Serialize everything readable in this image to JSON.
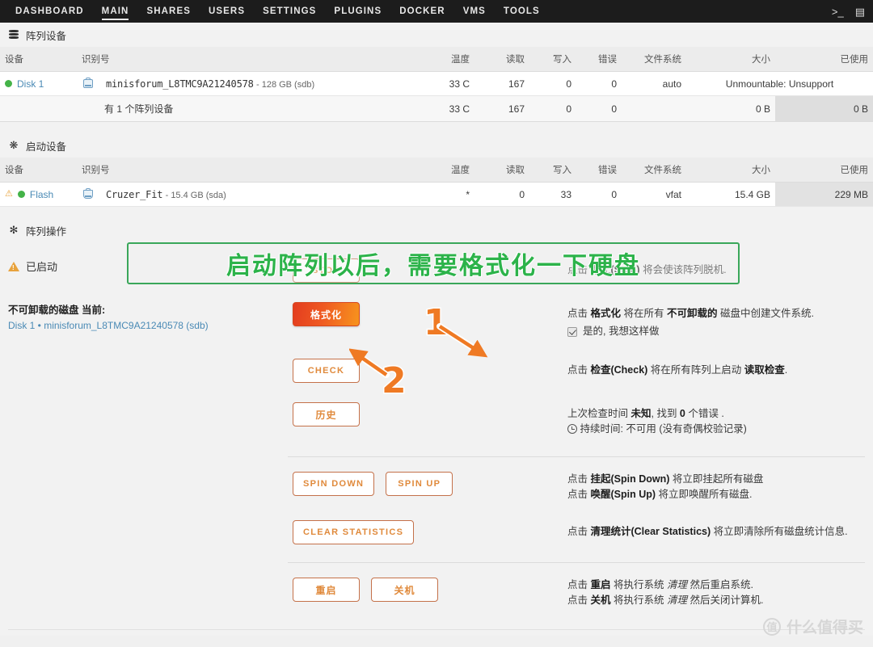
{
  "nav": {
    "items": [
      {
        "label": "DASHBOARD",
        "active": false
      },
      {
        "label": "MAIN",
        "active": true
      },
      {
        "label": "SHARES",
        "active": false
      },
      {
        "label": "USERS",
        "active": false
      },
      {
        "label": "SETTINGS",
        "active": false
      },
      {
        "label": "PLUGINS",
        "active": false
      },
      {
        "label": "DOCKER",
        "active": false
      },
      {
        "label": "VMS",
        "active": false
      },
      {
        "label": "TOOLS",
        "active": false
      }
    ],
    "right_icons": [
      "terminal-icon",
      "display-icon"
    ],
    "terminal_glyph": ">_",
    "display_glyph": "▤"
  },
  "array_section": {
    "title": "阵列设备",
    "columns": [
      "设备",
      "识别号",
      "温度",
      "读取",
      "写入",
      "错误",
      "文件系统",
      "大小",
      "已使用"
    ],
    "rows": [
      {
        "device": "Disk 1",
        "identifier": "minisforum_L8TMC9A21240578",
        "id_size": "- 128 GB (sdb)",
        "temp": "33 C",
        "reads": "167",
        "writes": "0",
        "errors": "0",
        "fs": "auto",
        "size": "Unmountable: Unsupport",
        "used": ""
      }
    ],
    "summary": {
      "label": "有 1 个阵列设备",
      "temp": "33 C",
      "reads": "167",
      "writes": "0",
      "errors": "0",
      "fs": "",
      "size": "0 B",
      "used": "0 B"
    }
  },
  "boot_section": {
    "title": "启动设备",
    "columns": [
      "设备",
      "识别号",
      "温度",
      "读取",
      "写入",
      "错误",
      "文件系统",
      "大小",
      "已使用"
    ],
    "rows": [
      {
        "device": "Flash",
        "identifier": "Cruzer_Fit",
        "id_size": "- 15.4 GB (sda)",
        "temp": "*",
        "reads": "0",
        "writes": "33",
        "errors": "0",
        "fs": "vfat",
        "size": "15.4 GB",
        "used": "229 MB"
      }
    ]
  },
  "ops_section": {
    "title": "阵列操作",
    "status_label": "已启动",
    "unmountable_title": "不可卸载的磁盘 当前:",
    "unmountable_value": "Disk 1 • minisforum_L8TMC9A21240578 (sdb)",
    "rows": [
      {
        "buttons": [
          {
            "label": "STOP",
            "style": "outline"
          }
        ],
        "desc_html": "点击 <b>停止(Stop)</b> 将会使该阵列脱机."
      },
      {
        "buttons": [
          {
            "label": "格式化",
            "style": "primary"
          }
        ],
        "desc_html": "点击 <b>格式化</b> 将在所有 <b>不可卸载的</b> 磁盘中创建文件系统.",
        "checkbox_label": "是的, 我想这样做",
        "checkbox_checked": true
      },
      {
        "buttons": [
          {
            "label": "CHECK",
            "style": "outline"
          }
        ],
        "desc_html": "点击 <b>检查(Check)</b> 将在所有阵列上启动 <b>读取检查</b>."
      },
      {
        "buttons": [
          {
            "label": "历史",
            "style": "outline"
          }
        ],
        "desc_html": "上次检查时间 <b>未知</b>, 找到 <b>0</b> 个错误 .",
        "desc_html2": "持续时间: 不可用 (没有奇偶校验记录)",
        "has_clock": true
      },
      {
        "buttons": [
          {
            "label": "SPIN DOWN",
            "style": "outline"
          },
          {
            "label": "SPIN UP",
            "style": "outline"
          }
        ],
        "desc_html": "点击 <b>挂起(Spin Down)</b> 将立即挂起所有磁盘",
        "desc_html2": "点击 <b>唤醒(Spin Up)</b> 将立即唤醒所有磁盘."
      },
      {
        "buttons": [
          {
            "label": "CLEAR STATISTICS",
            "style": "outline"
          }
        ],
        "desc_html": "点击 <b>清理统计(Clear Statistics)</b> 将立即清除所有磁盘统计信息."
      },
      {
        "buttons": [
          {
            "label": "重启",
            "style": "outline"
          },
          {
            "label": "关机",
            "style": "outline"
          }
        ],
        "desc_html": "点击 <b>重启</b> 将执行系统 <i>清理</i> 然后重启系统.",
        "desc_html2": "点击 <b>关机</b> 将执行系统 <i>清理</i> 然后关闭计算机."
      }
    ]
  },
  "annotations": {
    "box_text": "启动阵列以后，需要格式化一下硬盘",
    "marker_1": "1",
    "marker_2": "2",
    "box_color": "#3aa75a",
    "text_color": "#2cb34a",
    "marker_color": "#ef7a24"
  },
  "watermark": {
    "badge": "值",
    "text": "什么值得买"
  }
}
